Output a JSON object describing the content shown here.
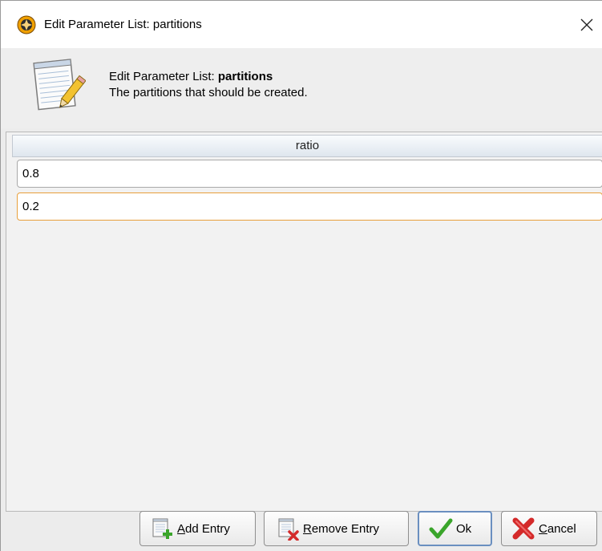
{
  "window": {
    "title": "Edit Parameter List: partitions"
  },
  "header": {
    "title_prefix": "Edit Parameter List: ",
    "title_name": "partitions",
    "description": "The partitions that should be created."
  },
  "table": {
    "column_header": "ratio",
    "entries": [
      {
        "value": "0.8",
        "focused": false
      },
      {
        "value": "0.2",
        "focused": true
      }
    ]
  },
  "buttons": {
    "add_first": "A",
    "add_rest": "dd Entry",
    "remove_first": "R",
    "remove_rest": "emove Entry",
    "ok": "Ok",
    "cancel_first": "C",
    "cancel_rest": "ancel"
  },
  "icons": {
    "app": "app-logo-icon",
    "close": "close-icon",
    "header": "notepad-pencil-icon",
    "add": "notepad-add-icon",
    "remove": "notepad-remove-icon",
    "ok": "checkmark-icon",
    "cancel": "red-x-icon"
  },
  "colors": {
    "focus_border": "#e8a03c",
    "ok_check": "#3aa52b",
    "cancel_x": "#d42a2a",
    "add_plus": "#3aa52b"
  }
}
